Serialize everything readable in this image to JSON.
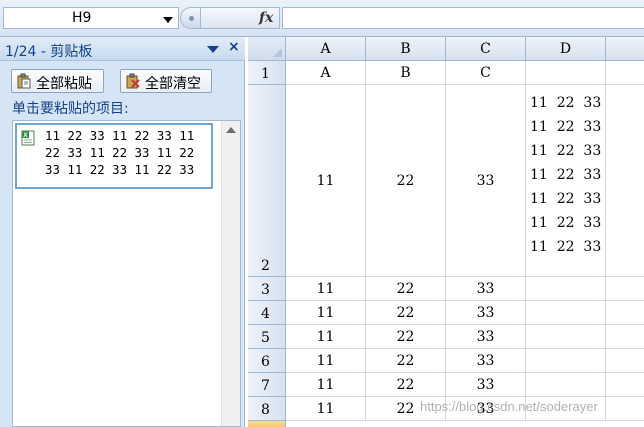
{
  "formula_bar": {
    "name_box": "H9",
    "fx_label": "fx",
    "formula": ""
  },
  "clipboard_pane": {
    "title": "1/24 - 剪贴板",
    "close": "×",
    "paste_all": "全部粘贴",
    "clear_all": "全部清空",
    "prompt": "单击要粘贴的项目:",
    "items": [
      {
        "icon": "excel-icon",
        "text": "11 22 33 11 22 33 11\n22 33 11 22 33 11 22\n33 11 22 33 11 22 33"
      }
    ]
  },
  "sheet": {
    "columns": [
      "A",
      "B",
      "C",
      "D"
    ],
    "rows": [
      {
        "num": "1",
        "cells": [
          "A",
          "B",
          "C",
          ""
        ]
      },
      {
        "num": "2",
        "cells": [
          "11",
          "22",
          "33",
          "11  22  33\n11  22  33\n11  22  33\n11  22  33\n11  22  33\n11  22  33\n11  22  33"
        ]
      },
      {
        "num": "3",
        "cells": [
          "11",
          "22",
          "33",
          ""
        ]
      },
      {
        "num": "4",
        "cells": [
          "11",
          "22",
          "33",
          ""
        ]
      },
      {
        "num": "5",
        "cells": [
          "11",
          "22",
          "33",
          ""
        ]
      },
      {
        "num": "6",
        "cells": [
          "11",
          "22",
          "33",
          ""
        ]
      },
      {
        "num": "7",
        "cells": [
          "11",
          "22",
          "33",
          ""
        ]
      },
      {
        "num": "8",
        "cells": [
          "11",
          "22",
          "33",
          ""
        ]
      }
    ]
  },
  "watermark": "https://blog.csdn.net/soderayer"
}
